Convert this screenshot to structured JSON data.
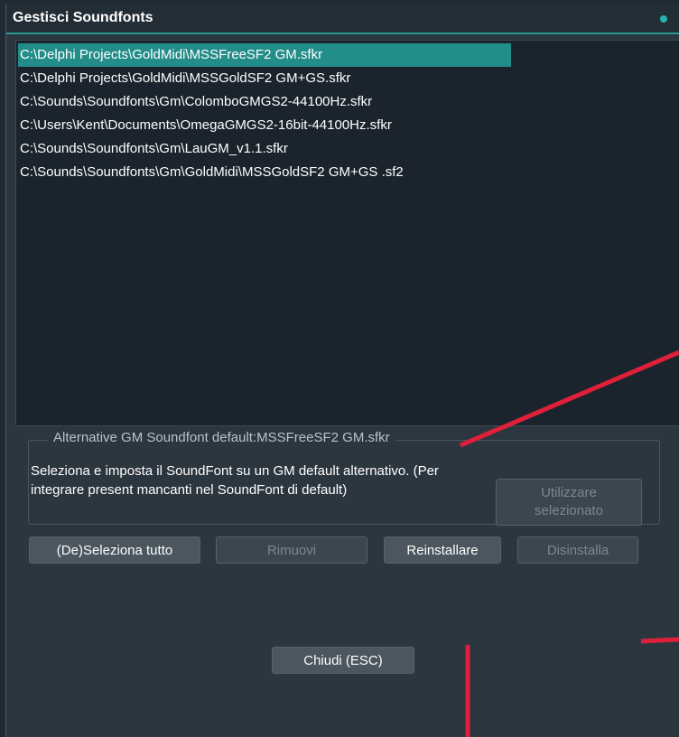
{
  "window": {
    "title": "Gestisci Soundfonts"
  },
  "soundfonts": [
    {
      "path": "C:\\Delphi Projects\\GoldMidi\\MSSFreeSF2 GM.sfkr",
      "selected": true
    },
    {
      "path": "C:\\Delphi Projects\\GoldMidi\\MSSGoldSF2 GM+GS.sfkr",
      "selected": false
    },
    {
      "path": "C:\\Sounds\\Soundfonts\\Gm\\ColomboGMGS2-44100Hz.sfkr",
      "selected": false
    },
    {
      "path": "C:\\Users\\Kent\\Documents\\OmegaGMGS2-16bit-44100Hz.sfkr",
      "selected": false
    },
    {
      "path": "C:\\Sounds\\Soundfonts\\Gm\\LauGM_v1.1.sfkr",
      "selected": false
    },
    {
      "path": "C:\\Sounds\\Soundfonts\\Gm\\GoldMidi\\MSSGoldSF2 GM+GS .sf2",
      "selected": false
    }
  ],
  "alternative": {
    "title": "Alternative GM Soundfont default:MSSFreeSF2 GM.sfkr",
    "description": "Seleziona e imposta il SoundFont su un GM default alternativo. (Per integrare present mancanti nel SoundFont di default)",
    "use_selected_line1": "Utilizzare",
    "use_selected_line2": "selezionato"
  },
  "buttons": {
    "toggle_select": "(De)Seleziona tutto",
    "remove": "Rimuovi",
    "reinstall": "Reinstallare",
    "uninstall": "Disinstalla",
    "close": "Chiudi (ESC)"
  },
  "colors": {
    "accent": "#238d89",
    "annotation": "#e0203a"
  }
}
